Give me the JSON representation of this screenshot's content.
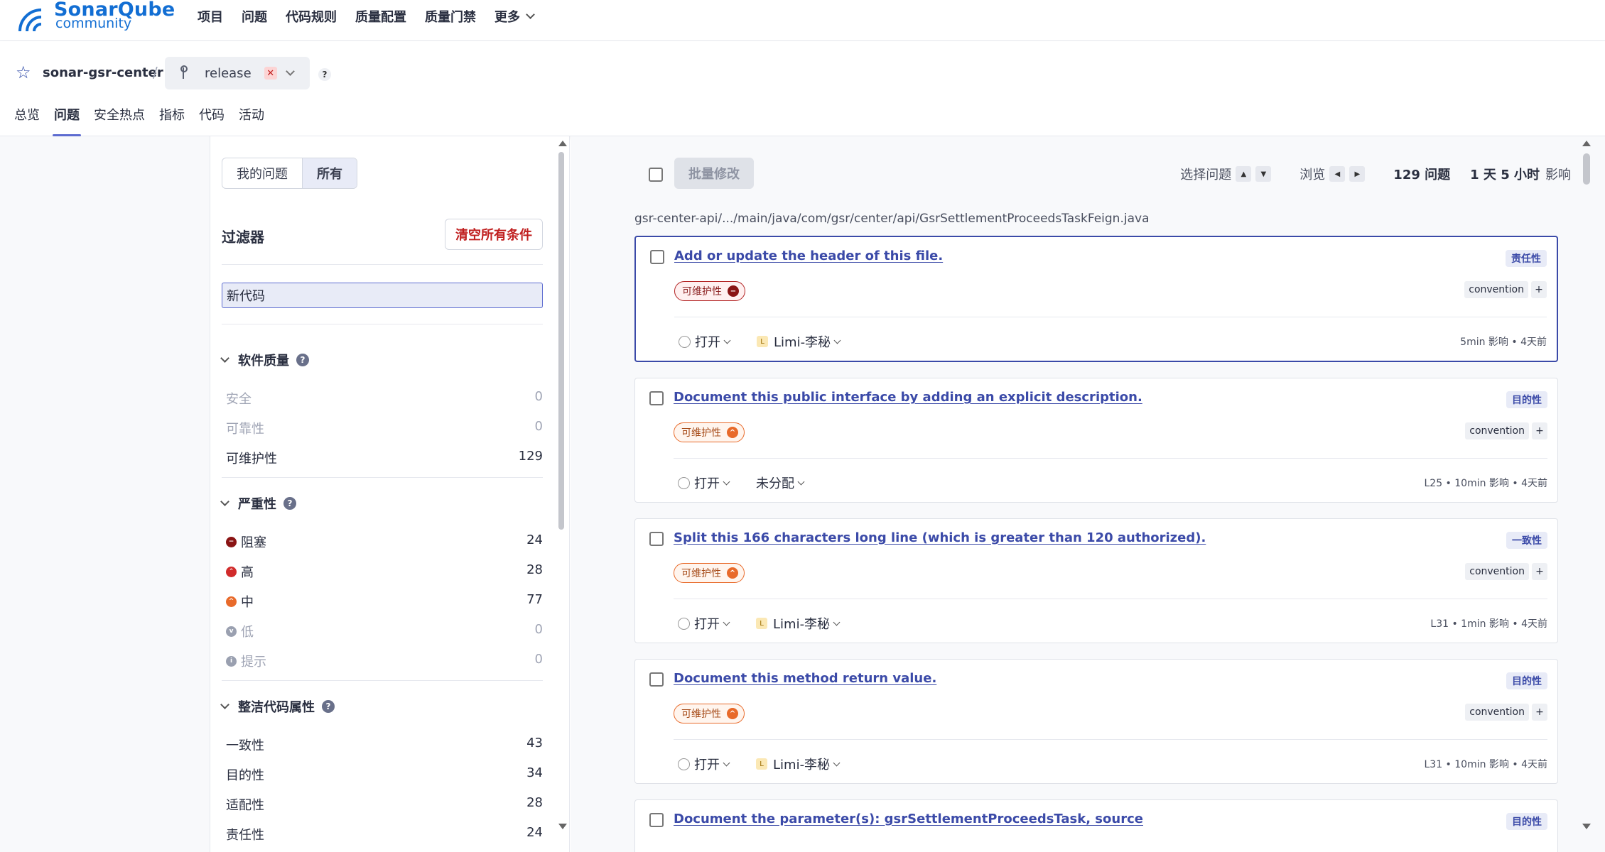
{
  "app": {
    "brand": "SonarQube",
    "edition": "community",
    "accent": "#126ed3"
  },
  "nav": {
    "items": [
      "项目",
      "问题",
      "代码规则",
      "质量配置",
      "质量门禁",
      "更多"
    ]
  },
  "project": {
    "name": "sonar-gsr-center",
    "separator": "/",
    "branch": "release",
    "help": "?"
  },
  "tabs": [
    "总览",
    "问题",
    "安全热点",
    "指标",
    "代码",
    "活动"
  ],
  "sidebar": {
    "toggle": {
      "mine": "我的问题",
      "all": "所有"
    },
    "filters_title": "过滤器",
    "clear_all": "清空所有条件",
    "new_code": "新代码",
    "software_quality": {
      "title": "软件质量",
      "items": [
        {
          "label": "安全",
          "count": "0"
        },
        {
          "label": "可靠性",
          "count": "0"
        },
        {
          "label": "可维护性",
          "count": "129"
        }
      ]
    },
    "severity": {
      "title": "严重性",
      "items": [
        {
          "label": "阻塞",
          "count": "24",
          "color": "#8a1414"
        },
        {
          "label": "高",
          "count": "28",
          "color": "#d12b2b"
        },
        {
          "label": "中",
          "count": "77",
          "color": "#e86a2a"
        },
        {
          "label": "低",
          "count": "0",
          "color": "#9aa0b0"
        },
        {
          "label": "提示",
          "count": "0",
          "color": "#9aa0b0"
        }
      ]
    },
    "clean_code": {
      "title": "整洁代码属性",
      "items": [
        {
          "label": "一致性",
          "count": "43"
        },
        {
          "label": "目的性",
          "count": "34"
        },
        {
          "label": "适配性",
          "count": "28"
        },
        {
          "label": "责任性",
          "count": "24"
        }
      ]
    }
  },
  "toolbar": {
    "bulk_change": "批量修改",
    "select_issues": "选择问题",
    "navigate": "浏览",
    "issue_count": "129 问题",
    "effort": "1 天 5 小时",
    "effort_suffix": "影响"
  },
  "file_path": "gsr-center-api/.../main/java/com/gsr/center/api/GsrSettlementProceedsTaskFeign.java",
  "issues": [
    {
      "title": "Add or update the header of this file.",
      "attribute": "责任性",
      "quality": "可维护性",
      "severity": "blocker",
      "tag": "convention",
      "status": "打开",
      "assignee": "Limi-李秘",
      "avatar": "L",
      "meta": "5min 影响 • 4天前"
    },
    {
      "title": "Document this public interface by adding an explicit description.",
      "attribute": "目的性",
      "quality": "可维护性",
      "severity": "medium",
      "tag": "convention",
      "status": "打开",
      "assignee": "未分配",
      "avatar": "",
      "meta": "L25 • 10min 影响 • 4天前"
    },
    {
      "title": "Split this 166 characters long line (which is greater than 120 authorized).",
      "attribute": "一致性",
      "quality": "可维护性",
      "severity": "medium",
      "tag": "convention",
      "status": "打开",
      "assignee": "Limi-李秘",
      "avatar": "L",
      "meta": "L31 • 1min 影响 • 4天前"
    },
    {
      "title": "Document this method return value.",
      "attribute": "目的性",
      "quality": "可维护性",
      "severity": "medium",
      "tag": "convention",
      "status": "打开",
      "assignee": "Limi-李秘",
      "avatar": "L",
      "meta": "L31 • 10min 影响 • 4天前"
    },
    {
      "title": "Document the parameter(s): gsrSettlementProceedsTask, source",
      "attribute": "目的性"
    }
  ]
}
